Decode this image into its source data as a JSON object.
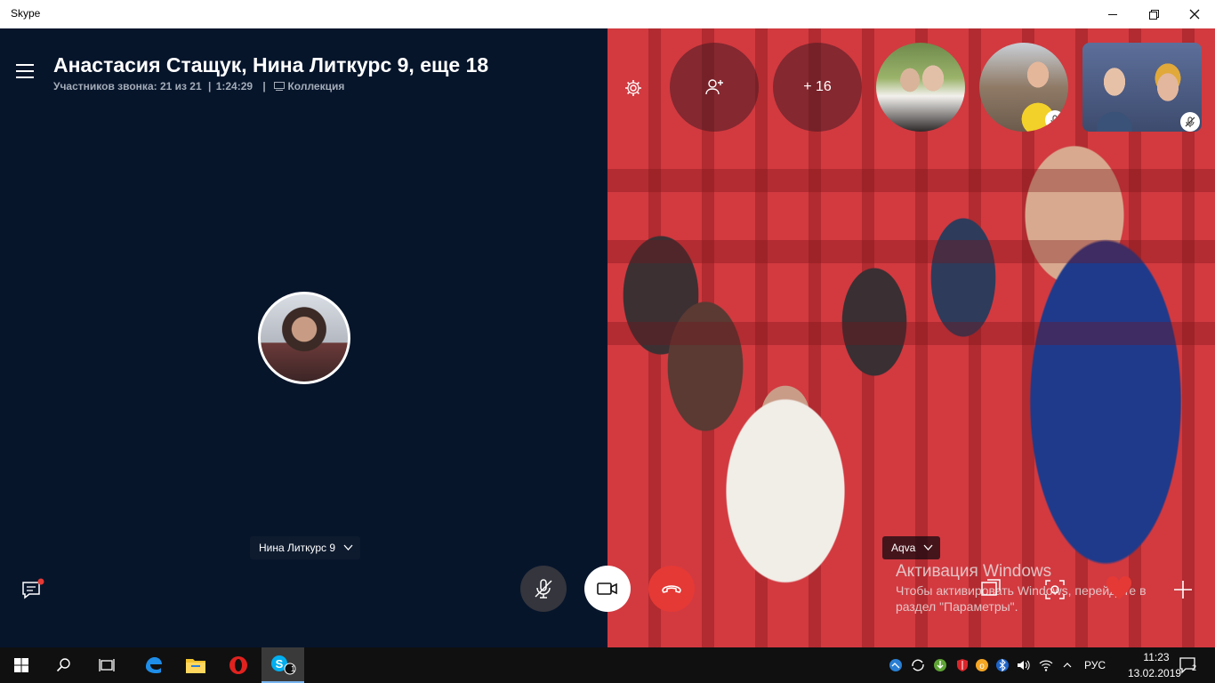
{
  "window": {
    "title": "Skype",
    "minimize_glyph": "—",
    "restore_glyph": "❐",
    "close_glyph": "✕"
  },
  "call": {
    "title": "Анастасия Стащук, Нина Литкурс 9, еще 18",
    "participants_label": "Участников звонка: 21 из 21",
    "separator": "|",
    "duration": "1:24:29",
    "separator2": "|",
    "collection_label": "Коллекция"
  },
  "left_participant": {
    "name": "Нина Литкурс 9",
    "chevron": "⌵"
  },
  "video_participant": {
    "name": "Aqva",
    "chevron": "⌵"
  },
  "top_bar": {
    "add_person_icon": "add-person-icon",
    "more_label": "+ 16"
  },
  "watermark": {
    "title": "Активация Windows",
    "line1": "Чтобы активировать Windows, перейдите в",
    "line2": "раздел \"Параметры\"."
  },
  "colors": {
    "left_bg": "#07152b",
    "end_call": "#e53935",
    "heart": "#e53935",
    "notification_dot": "#e53935"
  },
  "taskbar": {
    "skype_badge": "1",
    "language": "РУС",
    "time": "11:23",
    "date": "13.02.2019",
    "notifications_count": "2"
  }
}
